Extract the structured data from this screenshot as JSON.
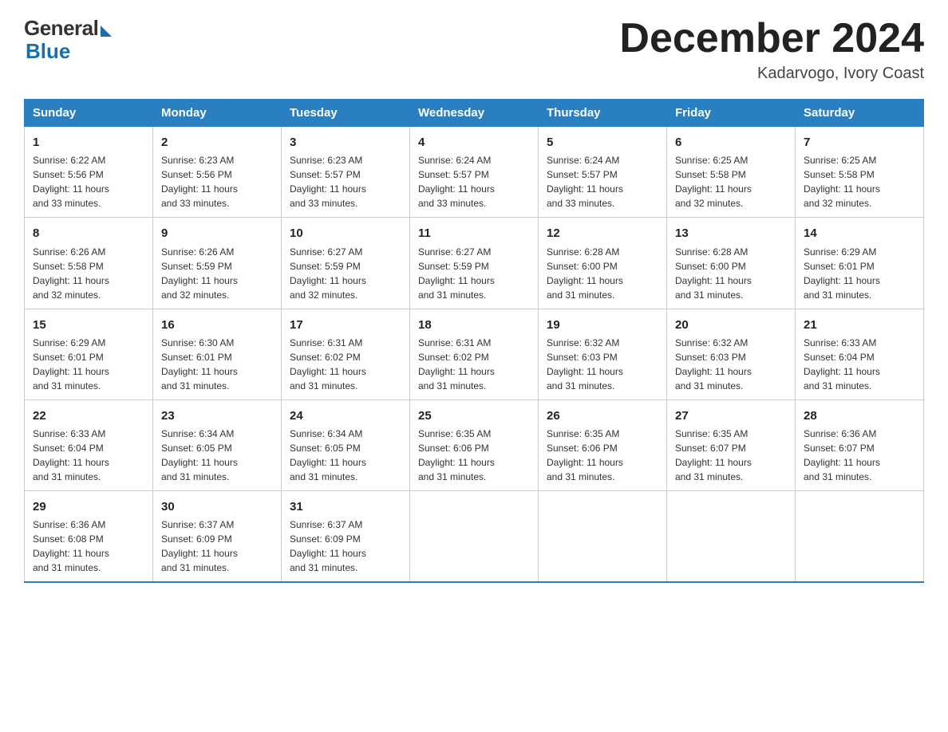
{
  "header": {
    "logo_general": "General",
    "logo_blue": "Blue",
    "month_title": "December 2024",
    "location": "Kadarvogo, Ivory Coast"
  },
  "days_of_week": [
    "Sunday",
    "Monday",
    "Tuesday",
    "Wednesday",
    "Thursday",
    "Friday",
    "Saturday"
  ],
  "weeks": [
    [
      {
        "day": "1",
        "sunrise": "6:22 AM",
        "sunset": "5:56 PM",
        "daylight": "11 hours and 33 minutes."
      },
      {
        "day": "2",
        "sunrise": "6:23 AM",
        "sunset": "5:56 PM",
        "daylight": "11 hours and 33 minutes."
      },
      {
        "day": "3",
        "sunrise": "6:23 AM",
        "sunset": "5:57 PM",
        "daylight": "11 hours and 33 minutes."
      },
      {
        "day": "4",
        "sunrise": "6:24 AM",
        "sunset": "5:57 PM",
        "daylight": "11 hours and 33 minutes."
      },
      {
        "day": "5",
        "sunrise": "6:24 AM",
        "sunset": "5:57 PM",
        "daylight": "11 hours and 33 minutes."
      },
      {
        "day": "6",
        "sunrise": "6:25 AM",
        "sunset": "5:58 PM",
        "daylight": "11 hours and 32 minutes."
      },
      {
        "day": "7",
        "sunrise": "6:25 AM",
        "sunset": "5:58 PM",
        "daylight": "11 hours and 32 minutes."
      }
    ],
    [
      {
        "day": "8",
        "sunrise": "6:26 AM",
        "sunset": "5:58 PM",
        "daylight": "11 hours and 32 minutes."
      },
      {
        "day": "9",
        "sunrise": "6:26 AM",
        "sunset": "5:59 PM",
        "daylight": "11 hours and 32 minutes."
      },
      {
        "day": "10",
        "sunrise": "6:27 AM",
        "sunset": "5:59 PM",
        "daylight": "11 hours and 32 minutes."
      },
      {
        "day": "11",
        "sunrise": "6:27 AM",
        "sunset": "5:59 PM",
        "daylight": "11 hours and 31 minutes."
      },
      {
        "day": "12",
        "sunrise": "6:28 AM",
        "sunset": "6:00 PM",
        "daylight": "11 hours and 31 minutes."
      },
      {
        "day": "13",
        "sunrise": "6:28 AM",
        "sunset": "6:00 PM",
        "daylight": "11 hours and 31 minutes."
      },
      {
        "day": "14",
        "sunrise": "6:29 AM",
        "sunset": "6:01 PM",
        "daylight": "11 hours and 31 minutes."
      }
    ],
    [
      {
        "day": "15",
        "sunrise": "6:29 AM",
        "sunset": "6:01 PM",
        "daylight": "11 hours and 31 minutes."
      },
      {
        "day": "16",
        "sunrise": "6:30 AM",
        "sunset": "6:01 PM",
        "daylight": "11 hours and 31 minutes."
      },
      {
        "day": "17",
        "sunrise": "6:31 AM",
        "sunset": "6:02 PM",
        "daylight": "11 hours and 31 minutes."
      },
      {
        "day": "18",
        "sunrise": "6:31 AM",
        "sunset": "6:02 PM",
        "daylight": "11 hours and 31 minutes."
      },
      {
        "day": "19",
        "sunrise": "6:32 AM",
        "sunset": "6:03 PM",
        "daylight": "11 hours and 31 minutes."
      },
      {
        "day": "20",
        "sunrise": "6:32 AM",
        "sunset": "6:03 PM",
        "daylight": "11 hours and 31 minutes."
      },
      {
        "day": "21",
        "sunrise": "6:33 AM",
        "sunset": "6:04 PM",
        "daylight": "11 hours and 31 minutes."
      }
    ],
    [
      {
        "day": "22",
        "sunrise": "6:33 AM",
        "sunset": "6:04 PM",
        "daylight": "11 hours and 31 minutes."
      },
      {
        "day": "23",
        "sunrise": "6:34 AM",
        "sunset": "6:05 PM",
        "daylight": "11 hours and 31 minutes."
      },
      {
        "day": "24",
        "sunrise": "6:34 AM",
        "sunset": "6:05 PM",
        "daylight": "11 hours and 31 minutes."
      },
      {
        "day": "25",
        "sunrise": "6:35 AM",
        "sunset": "6:06 PM",
        "daylight": "11 hours and 31 minutes."
      },
      {
        "day": "26",
        "sunrise": "6:35 AM",
        "sunset": "6:06 PM",
        "daylight": "11 hours and 31 minutes."
      },
      {
        "day": "27",
        "sunrise": "6:35 AM",
        "sunset": "6:07 PM",
        "daylight": "11 hours and 31 minutes."
      },
      {
        "day": "28",
        "sunrise": "6:36 AM",
        "sunset": "6:07 PM",
        "daylight": "11 hours and 31 minutes."
      }
    ],
    [
      {
        "day": "29",
        "sunrise": "6:36 AM",
        "sunset": "6:08 PM",
        "daylight": "11 hours and 31 minutes."
      },
      {
        "day": "30",
        "sunrise": "6:37 AM",
        "sunset": "6:09 PM",
        "daylight": "11 hours and 31 minutes."
      },
      {
        "day": "31",
        "sunrise": "6:37 AM",
        "sunset": "6:09 PM",
        "daylight": "11 hours and 31 minutes."
      },
      null,
      null,
      null,
      null
    ]
  ],
  "labels": {
    "sunrise": "Sunrise:",
    "sunset": "Sunset:",
    "daylight": "Daylight:"
  },
  "colors": {
    "header_bg": "#2a7fc1",
    "accent_blue": "#1a6fa8"
  }
}
